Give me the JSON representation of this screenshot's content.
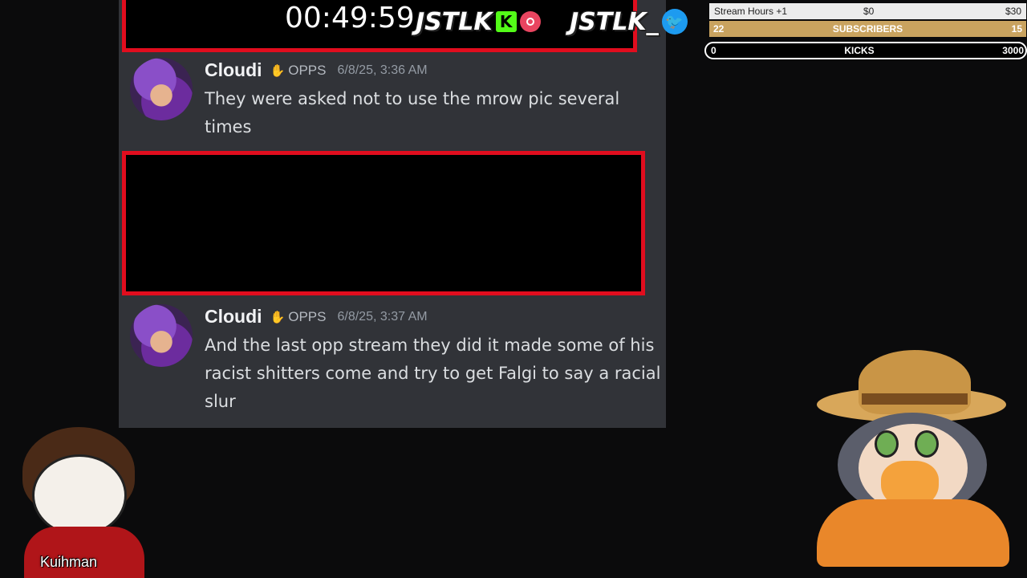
{
  "overlay": {
    "timer": "00:49:59",
    "logo_kick": "JSTLK",
    "logo_twitter": "JSTLK_",
    "stats": {
      "hours_label": "Stream Hours +1",
      "hours_current": "$0",
      "hours_goal": "$30",
      "subs_left": "22",
      "subs_label": "SUBSCRIBERS",
      "subs_right": "15",
      "kicks_left": "0",
      "kicks_label": "KICKS",
      "kicks_right": "3000"
    },
    "streamer_name": "Kuihman"
  },
  "messages": [
    {
      "username": "Cloudi",
      "tag": "OPPS",
      "timestamp": "6/8/25, 3:36 AM",
      "text": "They were asked not to use the mrow pic several times"
    },
    {
      "username": "Cloudi",
      "tag": "OPPS",
      "timestamp": "6/8/25, 3:37 AM",
      "text": "And the last opp stream they did it made some of his racist shitters come and try to get Falgi to say a racial slur"
    }
  ],
  "colors": {
    "discord_bg": "#313338",
    "redaction_border": "#e10d1e",
    "subs_bar": "#c9a35f",
    "kick_green": "#53fc18"
  }
}
